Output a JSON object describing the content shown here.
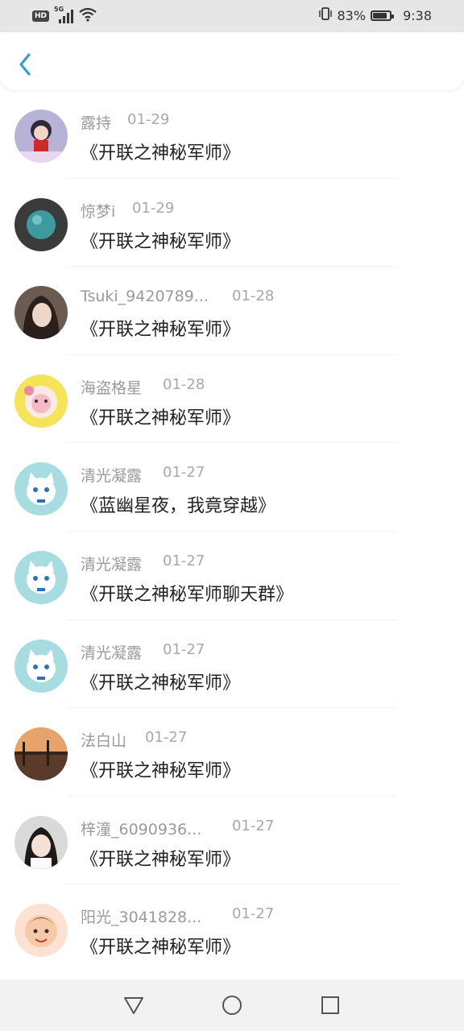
{
  "status_bar": {
    "network_badge": "HD",
    "network_type": "5G",
    "battery_percent": "83%",
    "battery_level": 0.83,
    "time": "9:38"
  },
  "header": {
    "back_icon": "chevron-left-icon",
    "accent_color": "#2f9bd6"
  },
  "items": [
    {
      "name": "露持",
      "date": "01-29",
      "title": "《开联之神秘军师》"
    },
    {
      "name": "惊梦i",
      "date": "01-29",
      "title": "《开联之神秘军师》"
    },
    {
      "name": "Tsuki_9420789...",
      "date": "01-28",
      "title": "《开联之神秘军师》"
    },
    {
      "name": "海盗格星",
      "date": "01-28",
      "title": "《开联之神秘军师》"
    },
    {
      "name": "清光凝露",
      "date": "01-27",
      "title": "《蓝幽星夜，我竟穿越》"
    },
    {
      "name": "清光凝露",
      "date": "01-27",
      "title": "《开联之神秘军师聊天群》"
    },
    {
      "name": "清光凝露",
      "date": "01-27",
      "title": "《开联之神秘军师》"
    },
    {
      "name": "法白山",
      "date": "01-27",
      "title": "《开联之神秘军师》"
    },
    {
      "name": "梓潼_6090936...",
      "date": "01-27",
      "title": "《开联之神秘军师》"
    },
    {
      "name": "阳光_3041828...",
      "date": "01-27",
      "title": "《开联之神秘军师》"
    }
  ],
  "nav_bar": {
    "back": "triangle-back-icon",
    "home": "circle-home-icon",
    "recents": "square-recents-icon"
  }
}
